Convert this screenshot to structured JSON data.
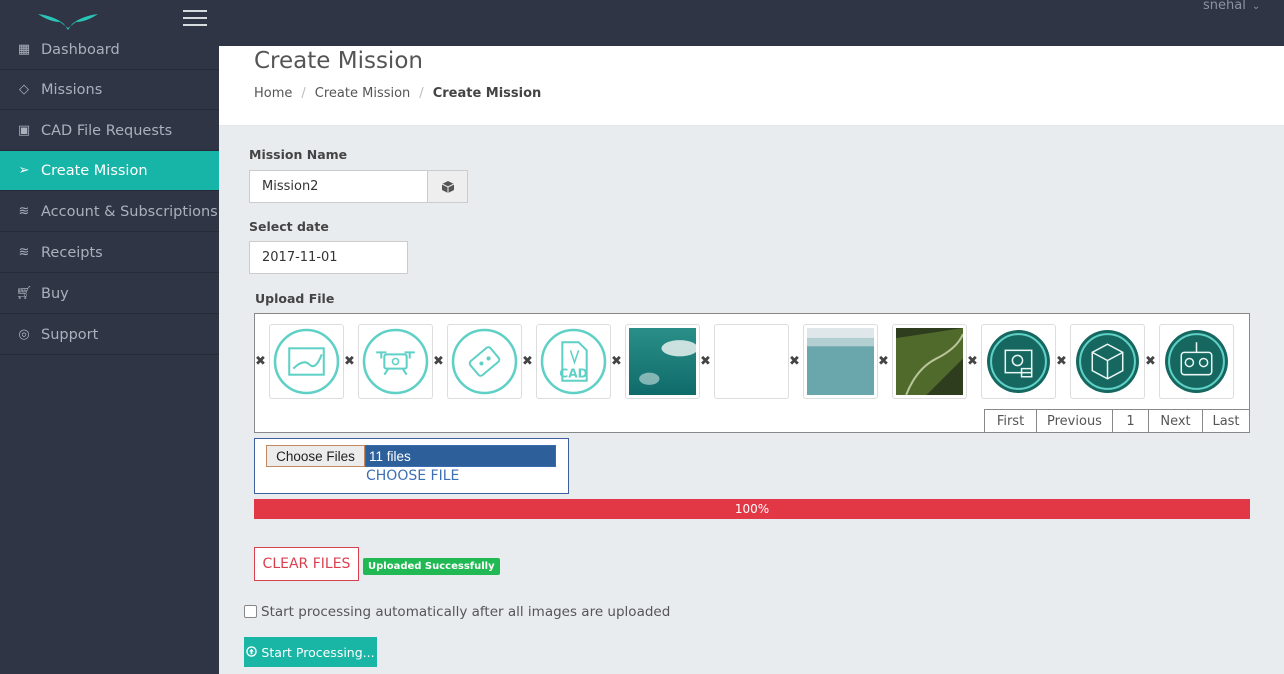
{
  "topbar": {
    "user_name": "snehal",
    "user_chevron": "⌄"
  },
  "sidebar": {
    "items": [
      {
        "label": "Dashboard",
        "icon": "dashboard-icon"
      },
      {
        "label": "Missions",
        "icon": "diamond-icon"
      },
      {
        "label": "CAD File Requests",
        "icon": "image-icon"
      },
      {
        "label": "Create Mission",
        "icon": "paper-plane-icon",
        "active": true
      },
      {
        "label": "Account & Subscriptions",
        "icon": "layers-icon"
      },
      {
        "label": "Receipts",
        "icon": "layers-icon"
      },
      {
        "label": "Buy",
        "icon": "cart-icon"
      },
      {
        "label": "Support",
        "icon": "life-ring-icon"
      }
    ]
  },
  "header": {
    "title": "Create Mission",
    "breadcrumb": [
      "Home",
      "Create Mission",
      "Create Mission"
    ]
  },
  "form": {
    "mission_name_label": "Mission Name",
    "mission_name_value": "Mission2",
    "date_label": "Select date",
    "date_value": "2017-11-01",
    "upload_label": "Upload File",
    "remove_symbol": "✖",
    "thumbnails": [
      {
        "kind": "map-route-icon"
      },
      {
        "kind": "drone-icon"
      },
      {
        "kind": "drone-route-icon"
      },
      {
        "kind": "cad-file-icon",
        "text": "CAD"
      },
      {
        "kind": "aerial-sea-photo"
      },
      {
        "kind": "blank-photo"
      },
      {
        "kind": "aerial-water-photo"
      },
      {
        "kind": "aerial-forest-road-photo"
      },
      {
        "kind": "survey-report-icon"
      },
      {
        "kind": "3d-box-icon"
      },
      {
        "kind": "remote-controller-icon"
      }
    ],
    "pager": {
      "first": "First",
      "previous": "Previous",
      "page": "1",
      "next": "Next",
      "last": "Last"
    },
    "choose_files_button": "Choose Files",
    "files_selected": "11 files",
    "choose_file_link": "CHOOSE FILE",
    "progress_percent": 100,
    "progress_label": "100%",
    "clear_files_button": "CLEAR FILES",
    "upload_status": "Uploaded Successfully",
    "auto_process_label": "Start processing automatically after all images are uploaded",
    "auto_process_checked": false,
    "start_processing_button": "Start Processing..."
  },
  "colors": {
    "sidebar_bg": "#2f3545",
    "accent_teal": "#17b5a7",
    "progress_red": "#e23745",
    "success_green": "#20b953",
    "danger": "#d9404f"
  }
}
